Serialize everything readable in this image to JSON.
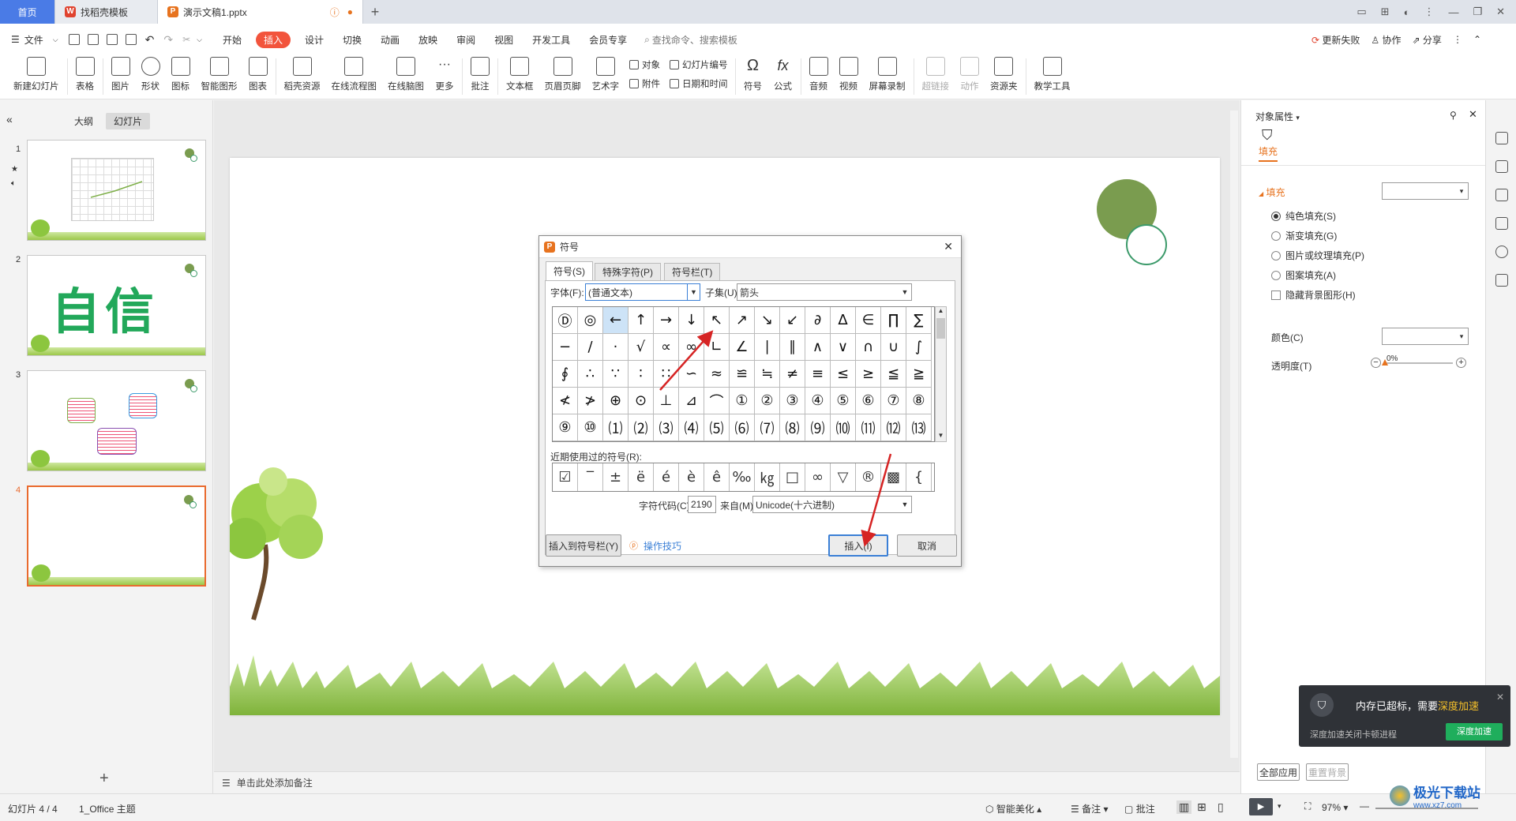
{
  "tabs": {
    "home": "首页",
    "template": "找稻壳模板",
    "doc": "演示文稿1.pptx"
  },
  "menu": {
    "file": "文件",
    "items": [
      "开始",
      "插入",
      "设计",
      "切换",
      "动画",
      "放映",
      "审阅",
      "视图",
      "开发工具",
      "会员专享"
    ],
    "search_placeholder": "查找命令、搜索模板",
    "update_failed": "更新失败",
    "collab": "协作",
    "share": "分享"
  },
  "ribbon": {
    "new_slide": "新建幻灯片",
    "table": "表格",
    "picture": "图片",
    "shape": "形状",
    "icon": "图标",
    "smartart": "智能图形",
    "chart": "图表",
    "docer": "稻壳资源",
    "flowchart": "在线流程图",
    "mindmap": "在线脑图",
    "more": "更多",
    "comment": "批注",
    "textbox": "文本框",
    "header_footer": "页眉页脚",
    "wordart": "艺术字",
    "object": "对象",
    "attachment": "附件",
    "slide_number": "幻灯片编号",
    "datetime": "日期和时间",
    "symbol": "符号",
    "formula": "公式",
    "audio": "音频",
    "video": "视频",
    "screen_record": "屏幕录制",
    "hyperlink": "超链接",
    "action": "动作",
    "resource": "资源夹",
    "teaching": "教学工具"
  },
  "left_panel": {
    "outline_tab": "大纲",
    "slides_tab": "幻灯片",
    "slide_numbers": [
      "1",
      "2",
      "3",
      "4"
    ],
    "slide2_text": "自信",
    "add_label": "+"
  },
  "notes_placeholder": "单击此处添加备注",
  "dialog": {
    "title": "符号",
    "tabs": [
      "符号(S)",
      "特殊字符(P)",
      "符号栏(T)"
    ],
    "font_label": "字体(F):",
    "font_value": "(普通文本)",
    "subset_label": "子集(U):",
    "subset_value": "箭头",
    "symbols": [
      [
        "Ⓓ",
        "◎",
        "←",
        "↑",
        "→",
        "↓",
        "↖",
        "↗",
        "↘",
        "↙",
        "∂",
        "∆",
        "∈",
        "∏",
        "∑"
      ],
      [
        "−",
        "/",
        "·",
        "√",
        "∝",
        "∞",
        "∟",
        "∠",
        "∣",
        "∥",
        "∧",
        "∨",
        "∩",
        "∪",
        "∫"
      ],
      [
        "∮",
        "∴",
        "∵",
        "∶",
        "∷",
        "∽",
        "≈",
        "≌",
        "≒",
        "≠",
        "≡",
        "≤",
        "≥",
        "≦",
        "≧"
      ],
      [
        "≮",
        "≯",
        "⊕",
        "⊙",
        "⊥",
        "⊿",
        "⌒",
        "①",
        "②",
        "③",
        "④",
        "⑤",
        "⑥",
        "⑦",
        "⑧"
      ],
      [
        "⑨",
        "⑩",
        "⑴",
        "⑵",
        "⑶",
        "⑷",
        "⑸",
        "⑹",
        "⑺",
        "⑻",
        "⑼",
        "⑽",
        "⑾",
        "⑿",
        "⒀"
      ]
    ],
    "recent_label": "近期使用过的符号(R):",
    "recent": [
      "☑",
      "‾",
      "±",
      "ë",
      "é",
      "è",
      "ê",
      "‰",
      "㎏",
      "□",
      "∞",
      "▽",
      "®",
      "▩",
      "{"
    ],
    "charcode_label": "字符代码(C):",
    "charcode_value": "2190",
    "from_label": "来自(M)",
    "from_value": "Unicode(十六进制)",
    "insert_to_bar": "插入到符号栏(Y)",
    "tips": "操作技巧",
    "insert": "插入(I)",
    "cancel": "取消"
  },
  "right_panel": {
    "title": "对象属性",
    "fill_tab": "填充",
    "fill_section": "填充",
    "options": [
      "纯色填充(S)",
      "渐变填充(G)",
      "图片或纹理填充(P)",
      "图案填充(A)"
    ],
    "hide_bg": "隐藏背景图形(H)",
    "color_label": "颜色(C)",
    "transparency_label": "透明度(T)",
    "transparency_value": "0%",
    "transparency_level": 0,
    "apply_all": "全部应用",
    "reset_bg": "重置背景"
  },
  "toast": {
    "message": "内存已超标，需要",
    "highlight": "深度加速",
    "sub": "深度加速关闭卡顿进程",
    "button": "深度加速"
  },
  "status": {
    "slide_pos": "幻灯片 4 / 4",
    "theme": "1_Office 主题",
    "beautify": "智能美化",
    "notes": "备注",
    "comments": "批注",
    "zoom": "97%"
  },
  "watermark": {
    "name": "极光下载站",
    "url": "www.xz7.com"
  },
  "colors": {
    "accent": "#f2543c",
    "home_tab": "#4a7be6",
    "selected_slide": "#e96a2e",
    "circle_green": "#7a9c4f",
    "arrow_red": "#d62424"
  }
}
